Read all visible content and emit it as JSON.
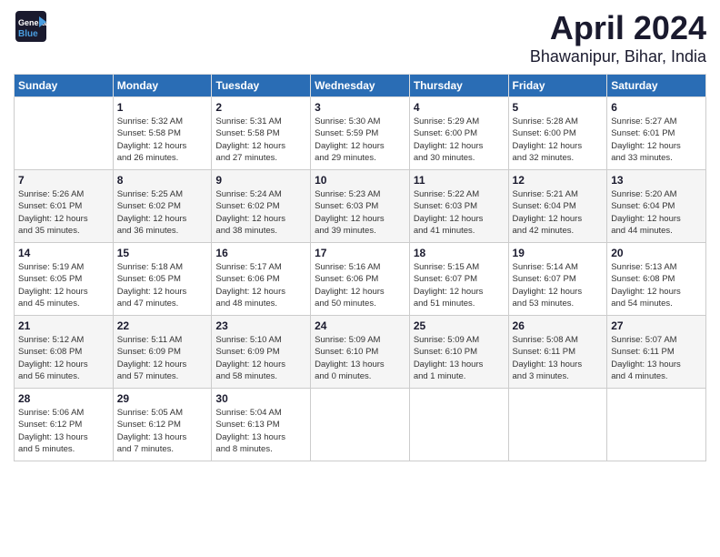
{
  "app": {
    "logo_general": "General",
    "logo_blue": "Blue"
  },
  "title": "April 2024",
  "subtitle": "Bhawanipur, Bihar, India",
  "weekdays": [
    "Sunday",
    "Monday",
    "Tuesday",
    "Wednesday",
    "Thursday",
    "Friday",
    "Saturday"
  ],
  "weeks": [
    [
      {
        "day": "",
        "info": ""
      },
      {
        "day": "1",
        "info": "Sunrise: 5:32 AM\nSunset: 5:58 PM\nDaylight: 12 hours\nand 26 minutes."
      },
      {
        "day": "2",
        "info": "Sunrise: 5:31 AM\nSunset: 5:58 PM\nDaylight: 12 hours\nand 27 minutes."
      },
      {
        "day": "3",
        "info": "Sunrise: 5:30 AM\nSunset: 5:59 PM\nDaylight: 12 hours\nand 29 minutes."
      },
      {
        "day": "4",
        "info": "Sunrise: 5:29 AM\nSunset: 6:00 PM\nDaylight: 12 hours\nand 30 minutes."
      },
      {
        "day": "5",
        "info": "Sunrise: 5:28 AM\nSunset: 6:00 PM\nDaylight: 12 hours\nand 32 minutes."
      },
      {
        "day": "6",
        "info": "Sunrise: 5:27 AM\nSunset: 6:01 PM\nDaylight: 12 hours\nand 33 minutes."
      }
    ],
    [
      {
        "day": "7",
        "info": "Sunrise: 5:26 AM\nSunset: 6:01 PM\nDaylight: 12 hours\nand 35 minutes."
      },
      {
        "day": "8",
        "info": "Sunrise: 5:25 AM\nSunset: 6:02 PM\nDaylight: 12 hours\nand 36 minutes."
      },
      {
        "day": "9",
        "info": "Sunrise: 5:24 AM\nSunset: 6:02 PM\nDaylight: 12 hours\nand 38 minutes."
      },
      {
        "day": "10",
        "info": "Sunrise: 5:23 AM\nSunset: 6:03 PM\nDaylight: 12 hours\nand 39 minutes."
      },
      {
        "day": "11",
        "info": "Sunrise: 5:22 AM\nSunset: 6:03 PM\nDaylight: 12 hours\nand 41 minutes."
      },
      {
        "day": "12",
        "info": "Sunrise: 5:21 AM\nSunset: 6:04 PM\nDaylight: 12 hours\nand 42 minutes."
      },
      {
        "day": "13",
        "info": "Sunrise: 5:20 AM\nSunset: 6:04 PM\nDaylight: 12 hours\nand 44 minutes."
      }
    ],
    [
      {
        "day": "14",
        "info": "Sunrise: 5:19 AM\nSunset: 6:05 PM\nDaylight: 12 hours\nand 45 minutes."
      },
      {
        "day": "15",
        "info": "Sunrise: 5:18 AM\nSunset: 6:05 PM\nDaylight: 12 hours\nand 47 minutes."
      },
      {
        "day": "16",
        "info": "Sunrise: 5:17 AM\nSunset: 6:06 PM\nDaylight: 12 hours\nand 48 minutes."
      },
      {
        "day": "17",
        "info": "Sunrise: 5:16 AM\nSunset: 6:06 PM\nDaylight: 12 hours\nand 50 minutes."
      },
      {
        "day": "18",
        "info": "Sunrise: 5:15 AM\nSunset: 6:07 PM\nDaylight: 12 hours\nand 51 minutes."
      },
      {
        "day": "19",
        "info": "Sunrise: 5:14 AM\nSunset: 6:07 PM\nDaylight: 12 hours\nand 53 minutes."
      },
      {
        "day": "20",
        "info": "Sunrise: 5:13 AM\nSunset: 6:08 PM\nDaylight: 12 hours\nand 54 minutes."
      }
    ],
    [
      {
        "day": "21",
        "info": "Sunrise: 5:12 AM\nSunset: 6:08 PM\nDaylight: 12 hours\nand 56 minutes."
      },
      {
        "day": "22",
        "info": "Sunrise: 5:11 AM\nSunset: 6:09 PM\nDaylight: 12 hours\nand 57 minutes."
      },
      {
        "day": "23",
        "info": "Sunrise: 5:10 AM\nSunset: 6:09 PM\nDaylight: 12 hours\nand 58 minutes."
      },
      {
        "day": "24",
        "info": "Sunrise: 5:09 AM\nSunset: 6:10 PM\nDaylight: 13 hours\nand 0 minutes."
      },
      {
        "day": "25",
        "info": "Sunrise: 5:09 AM\nSunset: 6:10 PM\nDaylight: 13 hours\nand 1 minute."
      },
      {
        "day": "26",
        "info": "Sunrise: 5:08 AM\nSunset: 6:11 PM\nDaylight: 13 hours\nand 3 minutes."
      },
      {
        "day": "27",
        "info": "Sunrise: 5:07 AM\nSunset: 6:11 PM\nDaylight: 13 hours\nand 4 minutes."
      }
    ],
    [
      {
        "day": "28",
        "info": "Sunrise: 5:06 AM\nSunset: 6:12 PM\nDaylight: 13 hours\nand 5 minutes."
      },
      {
        "day": "29",
        "info": "Sunrise: 5:05 AM\nSunset: 6:12 PM\nDaylight: 13 hours\nand 7 minutes."
      },
      {
        "day": "30",
        "info": "Sunrise: 5:04 AM\nSunset: 6:13 PM\nDaylight: 13 hours\nand 8 minutes."
      },
      {
        "day": "",
        "info": ""
      },
      {
        "day": "",
        "info": ""
      },
      {
        "day": "",
        "info": ""
      },
      {
        "day": "",
        "info": ""
      }
    ]
  ]
}
